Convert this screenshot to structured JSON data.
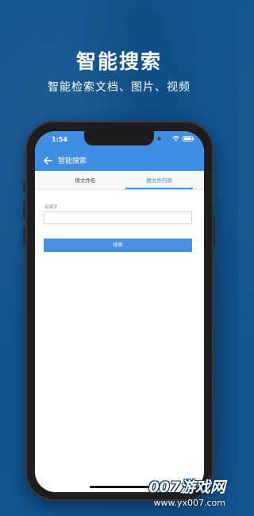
{
  "promo": {
    "title": "智能搜索",
    "subtitle": "智能检索文档、图片、视频"
  },
  "status_bar": {
    "time": "1:54",
    "icons": [
      "wifi-icon",
      "battery-icon"
    ]
  },
  "app_bar": {
    "back_icon": "arrow-left-icon",
    "title": "智能搜索"
  },
  "tabs": [
    {
      "label": "搜文件名",
      "selected": false
    },
    {
      "label": "搜文件内容",
      "selected": true
    }
  ],
  "search_form": {
    "keyword_label": "关键字",
    "keyword_value": "",
    "button_label": "搜索"
  },
  "watermark": {
    "line1": "007游戏网",
    "line2": "www.yx007.com"
  },
  "colors": {
    "background": "#11548f",
    "accent": "#3e8ee3",
    "button": "#4a90e2"
  }
}
